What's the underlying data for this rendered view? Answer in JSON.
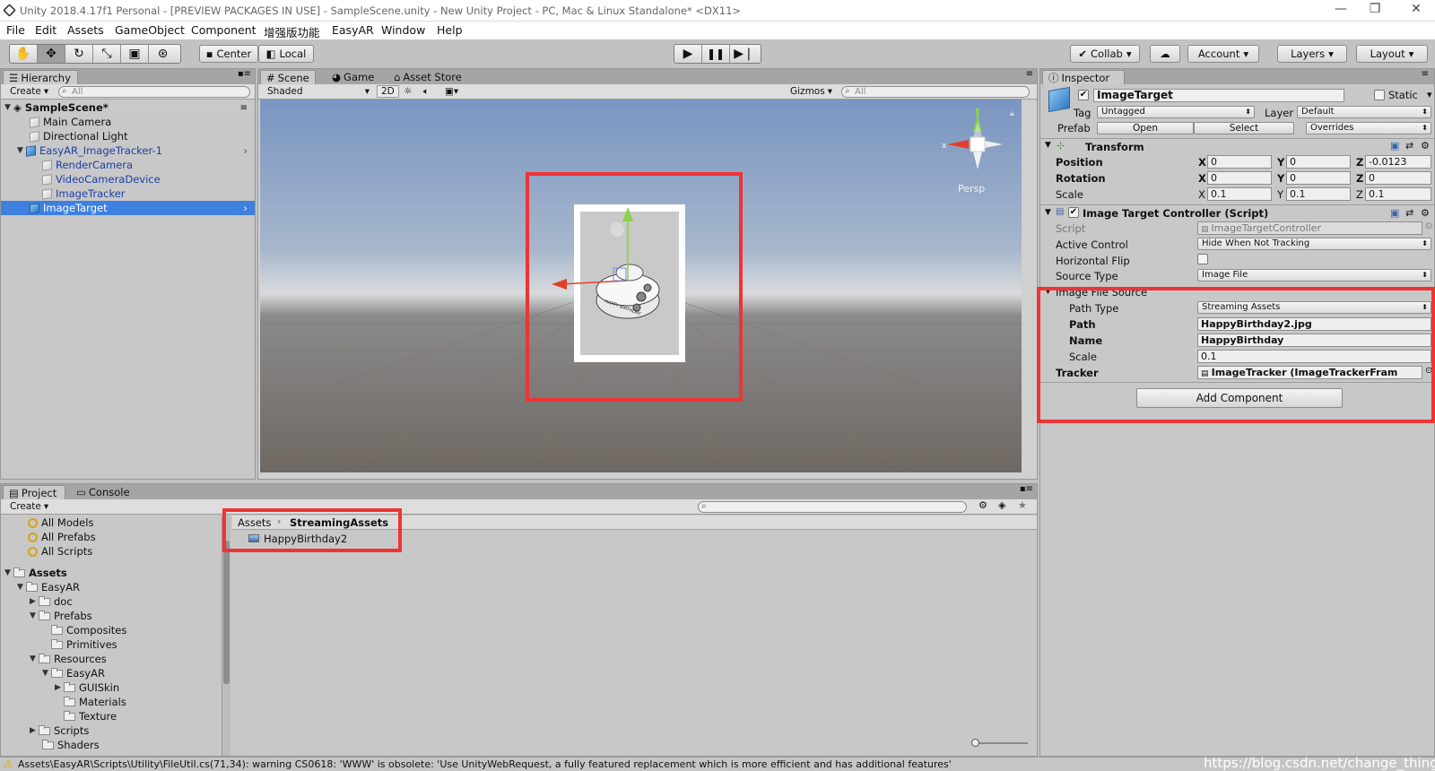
{
  "window": {
    "title": "Unity 2018.4.17f1 Personal - [PREVIEW PACKAGES IN USE] - SampleScene.unity - New Unity Project - PC, Mac & Linux Standalone* <DX11>"
  },
  "menu": [
    "File",
    "Edit",
    "Assets",
    "GameObject",
    "Component",
    "增强版功能",
    "EasyAR",
    "Window",
    "Help"
  ],
  "toolbar": {
    "pivot": "Center",
    "space": "Local",
    "collab": "Collab",
    "account": "Account",
    "layers": "Layers",
    "layout": "Layout"
  },
  "hierarchy": {
    "tab": "Hierarchy",
    "create": "Create",
    "search_placeholder": "All",
    "scene": "SampleScene*",
    "items": [
      {
        "label": "Main Camera"
      },
      {
        "label": "Directional Light"
      },
      {
        "label": "EasyAR_ImageTracker-1"
      },
      {
        "label": "RenderCamera"
      },
      {
        "label": "VideoCameraDevice"
      },
      {
        "label": "ImageTracker"
      },
      {
        "label": "ImageTarget"
      }
    ]
  },
  "scene": {
    "tabs": [
      "Scene",
      "Game",
      "Asset Store"
    ],
    "shading": "Shaded",
    "mode2d": "2D",
    "gizmos": "Gizmos",
    "search_placeholder": "All",
    "persp": "Persp",
    "card_text": "HAPPY BIRTHDAY"
  },
  "inspector": {
    "tab": "Inspector",
    "object_name": "ImageTarget",
    "static_label": "Static",
    "tag_label": "Tag",
    "tag_value": "Untagged",
    "layer_label": "Layer",
    "layer_value": "Default",
    "prefab_label": "Prefab",
    "prefab_open": "Open",
    "prefab_select": "Select",
    "prefab_overrides": "Overrides",
    "transform": {
      "title": "Transform",
      "position": {
        "label": "Position",
        "x": "0",
        "y": "0",
        "z": "-0.0123"
      },
      "rotation": {
        "label": "Rotation",
        "x": "0",
        "y": "0",
        "z": "0"
      },
      "scale": {
        "label": "Scale",
        "x": "0.1",
        "y": "0.1",
        "z": "0.1"
      }
    },
    "controller": {
      "title": "Image Target Controller (Script)",
      "script_label": "Script",
      "script_value": "ImageTargetController",
      "active_control_label": "Active Control",
      "active_control_value": "Hide When Not Tracking",
      "horizontal_flip_label": "Horizontal Flip",
      "source_type_label": "Source Type",
      "source_type_value": "Image File",
      "image_file_source_label": "Image File Source",
      "path_type_label": "Path Type",
      "path_type_value": "Streaming Assets",
      "path_label": "Path",
      "path_value": "HappyBirthday2.jpg",
      "name_label": "Name",
      "name_value": "HappyBirthday",
      "scale_label": "Scale",
      "scale_value": "0.1",
      "tracker_label": "Tracker",
      "tracker_value": "ImageTracker (ImageTrackerFram"
    },
    "add_component": "Add Component"
  },
  "project": {
    "tabs": [
      "Project",
      "Console"
    ],
    "create": "Create",
    "favorites": [
      "All Models",
      "All Prefabs",
      "All Scripts"
    ],
    "tree": [
      {
        "label": "Assets"
      },
      {
        "label": "EasyAR"
      },
      {
        "label": "doc"
      },
      {
        "label": "Prefabs"
      },
      {
        "label": "Composites"
      },
      {
        "label": "Primitives"
      },
      {
        "label": "Resources"
      },
      {
        "label": "EasyAR"
      },
      {
        "label": "GUISkin"
      },
      {
        "label": "Materials"
      },
      {
        "label": "Texture"
      },
      {
        "label": "Scripts"
      },
      {
        "label": "Shaders"
      }
    ],
    "breadcrumb_root": "Assets",
    "breadcrumb_leaf": "StreamingAssets",
    "files": [
      "HappyBirthday2"
    ]
  },
  "status": {
    "message": "Assets\\EasyAR\\Scripts\\Utility\\FileUtil.cs(71,34): warning CS0618: 'WWW' is obsolete: 'Use UnityWebRequest, a fully featured replacement which is more efficient and has additional features'",
    "watermark": "https://blog.csdn.net/change_things"
  },
  "colors": {
    "highlight": "#ee3434",
    "selection": "#3d80df",
    "link_blue": "#1a3ea8"
  }
}
